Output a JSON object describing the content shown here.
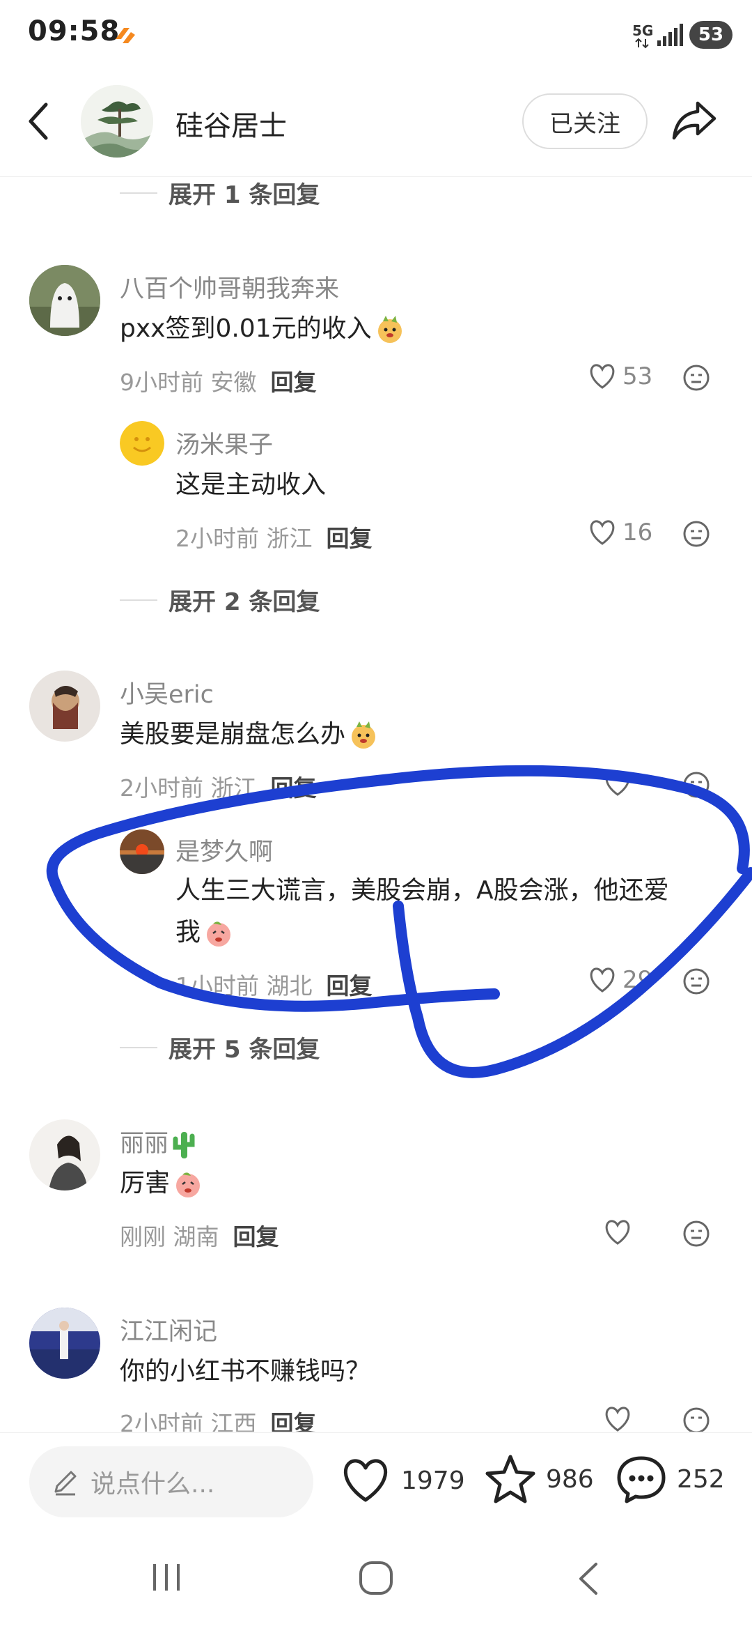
{
  "status_bar": {
    "time": "09:58",
    "network": "5G",
    "battery": "53",
    "accent": "#f5891f"
  },
  "header": {
    "author": "硅谷居士",
    "follow_label": "已关注"
  },
  "thread_top": {
    "expand_label": "展开 1 条回复"
  },
  "comments": [
    {
      "name": "八百个帅哥朝我奔来",
      "text": "pxx签到0.01元的收入",
      "time": "9小时前",
      "location": "安徽",
      "reply_label": "回复",
      "likes": "53",
      "replies": [
        {
          "name": "汤米果子",
          "text": "这是主动收入",
          "time": "2小时前",
          "location": "浙江",
          "reply_label": "回复",
          "likes": "16"
        }
      ],
      "expand_label": "展开 2 条回复"
    },
    {
      "name": "小吴eric",
      "text": "美股要是崩盘怎么办",
      "time": "2小时前",
      "location": "浙江",
      "reply_label": "回复",
      "likes": "",
      "replies": [
        {
          "name": "是梦久啊",
          "text_line1": "人生三大谎言，美股会崩，A股会涨，他还爱",
          "text_line2": "我",
          "time": "1小时前",
          "location": "湖北",
          "reply_label": "回复",
          "likes": "29"
        }
      ],
      "expand_label": "展开 5 条回复"
    },
    {
      "name": "丽丽",
      "text": "厉害",
      "time": "刚刚",
      "location": "湖南",
      "reply_label": "回复",
      "likes": ""
    },
    {
      "name": "江江闲记",
      "text": "你的小红书不赚钱吗？",
      "time": "2小时前",
      "location": "江西",
      "reply_label": "回复",
      "likes": ""
    }
  ],
  "bottom_bar": {
    "input_placeholder": "说点什么...",
    "likes": "1979",
    "stars": "986",
    "comments": "252"
  },
  "annotation": {
    "color": "#1d3fd1"
  }
}
